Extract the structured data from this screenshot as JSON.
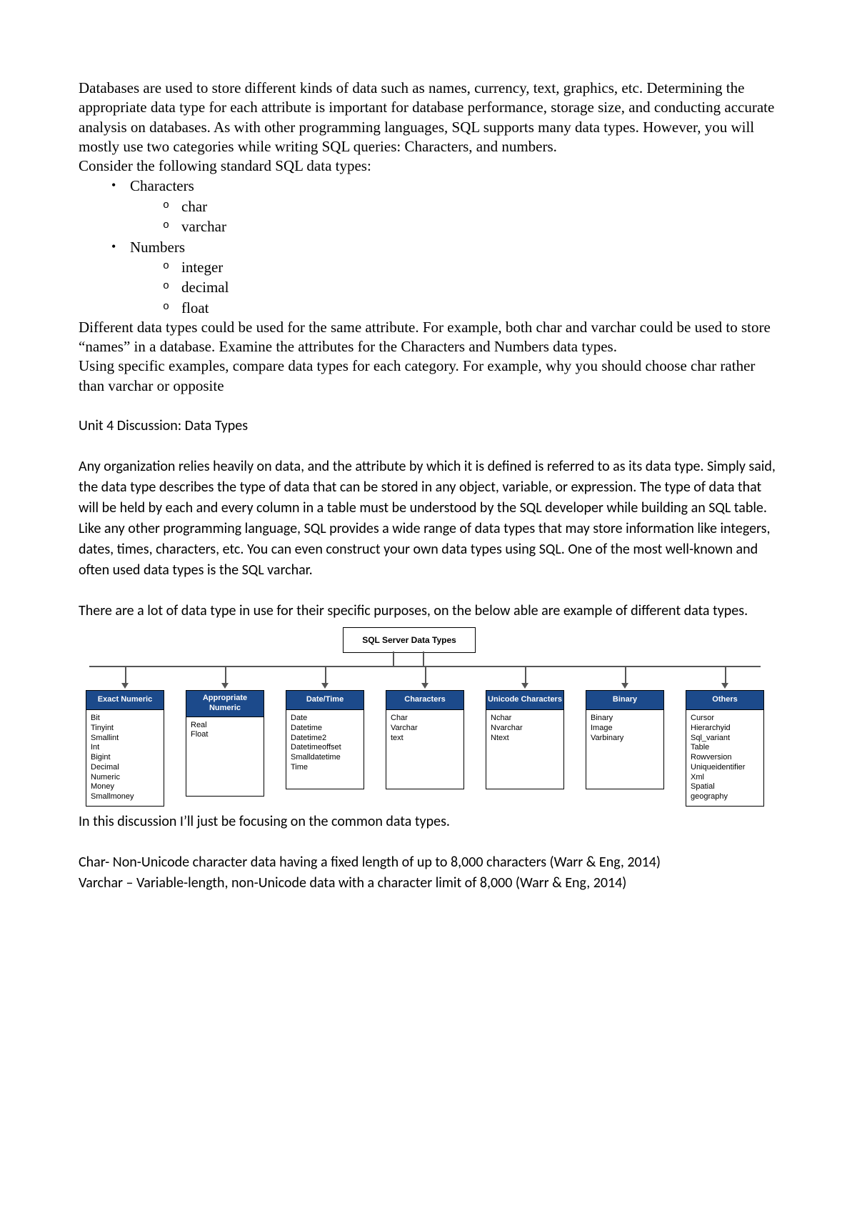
{
  "intro1": "Databases are used to store different kinds of data such as names, currency, text, graphics, etc. Determining the appropriate data type for each attribute is important for database performance, storage size, and conducting accurate analysis on databases. As with other programming languages, SQL supports many data types. However, you will mostly use two categories while writing SQL queries: Characters, and numbers.",
  "intro2": "Consider the following standard SQL data types:",
  "list": {
    "cat1": "Characters",
    "cat1_items": [
      "char",
      "varchar"
    ],
    "cat2": "Numbers",
    "cat2_items": [
      "integer",
      "decimal",
      "float"
    ]
  },
  "para1": "Different data types could be used for the same attribute. For example, both char and varchar could be used to store “names” in a database. Examine the attributes for the Characters and Numbers data types.",
  "para2": "Using specific examples, compare data types for each category. For example, why you should choose char rather than varchar or opposite",
  "heading1": "Unit 4 Discussion: Data Types",
  "sans_p1": "Any organization relies heavily on data, and the attribute by which it is defined is referred to as its data type. Simply said, the data type describes the type of data that can be stored in any object, variable, or expression. The type of data that will be held by each and every column in a table must be understood by the SQL developer while building an SQL table. Like any other programming language, SQL provides a wide range of data types that may store information like integers, dates, times, characters, etc. You can even construct your own data types using SQL. One of the most well-known and often used data types is the SQL varchar.",
  "sans_p2": "There are a lot of data type in use for their specific purposes, on the below able are example of different data types.",
  "sans_p3": "In this discussion I’ll just be focusing on the common data types.",
  "sans_p4": "Char- Non-Unicode character data having a fixed length of up to 8,000 characters (Warr & Eng, 2014)",
  "sans_p5": "Varchar – Variable-length, non-Unicode data with a character limit of 8,000 (Warr & Eng, 2014)",
  "chart_data": {
    "type": "tree",
    "title": "SQL Server Data Types",
    "columns": [
      {
        "head": "Exact Numeric",
        "items": [
          "Bit",
          "Tinyint",
          "Smallint",
          "Int",
          "Bigint",
          "Decimal",
          "Numeric",
          "Money",
          "Smallmoney"
        ]
      },
      {
        "head": "Appropriate Numeric",
        "items": [
          "Real",
          "Float"
        ]
      },
      {
        "head": "Date/Time",
        "items": [
          "Date",
          "Datetime",
          "Datetime2",
          "Datetimeoffset",
          "Smalldatetime",
          "Time"
        ]
      },
      {
        "head": "Characters",
        "items": [
          "Char",
          "Varchar",
          "text"
        ]
      },
      {
        "head": "Unicode Characters",
        "items": [
          "Nchar",
          "Nvarchar",
          "Ntext"
        ]
      },
      {
        "head": "Binary",
        "items": [
          "Binary",
          "Image",
          "Varbinary"
        ]
      },
      {
        "head": "Others",
        "items": [
          "Cursor",
          "Hierarchyid",
          "Sql_variant",
          "Table",
          "Rowversion",
          "Uniqueidentifier",
          "Xml",
          "Spatial",
          "geography"
        ]
      }
    ]
  }
}
